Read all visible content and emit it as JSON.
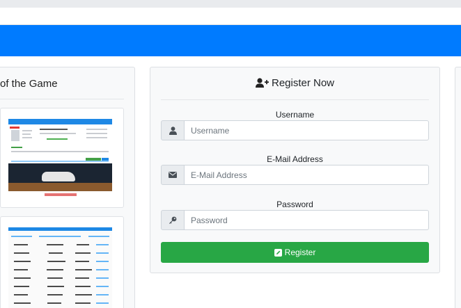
{
  "screenshots": {
    "title": "of the Game"
  },
  "register": {
    "title": "Register Now",
    "username": {
      "label": "Username",
      "placeholder": "Username",
      "value": ""
    },
    "email": {
      "label": "E-Mail Address",
      "placeholder": "E-Mail Address",
      "value": ""
    },
    "password": {
      "label": "Password",
      "placeholder": "Password",
      "value": ""
    },
    "submit_label": "Register"
  },
  "colors": {
    "navbar": "#007bff",
    "button": "#28a745",
    "card_bg": "#f8f9fa"
  },
  "icons": {
    "header": "user-plus-icon",
    "username": "user-icon",
    "email": "envelope-icon",
    "password": "key-icon",
    "submit": "edit-icon"
  }
}
